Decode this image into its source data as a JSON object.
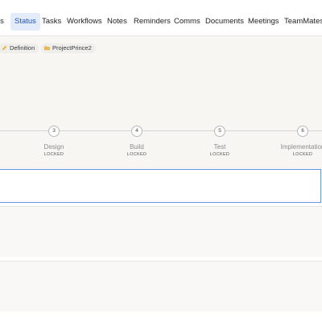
{
  "tabs": [
    {
      "label": "ls",
      "active": false
    },
    {
      "label": "Status",
      "active": true
    },
    {
      "label": "Tasks",
      "active": false
    },
    {
      "label": "Workflows",
      "active": false
    },
    {
      "label": "Notes",
      "active": false
    },
    {
      "label": "Reminders",
      "active": false
    },
    {
      "label": "Comms",
      "active": false
    },
    {
      "label": "Documents",
      "active": false
    },
    {
      "label": "Meetings",
      "active": false
    },
    {
      "label": "TeamMates",
      "active": false
    }
  ],
  "chips": [
    {
      "label": "Definition",
      "icon": "pencil-icon"
    },
    {
      "label": "ProjectPrince2",
      "icon": "folder-icon"
    }
  ],
  "stages": [
    {
      "number": "3",
      "name": "Design",
      "state": "LOCKED"
    },
    {
      "number": "4",
      "name": "Build",
      "state": "LOCKED"
    },
    {
      "number": "5",
      "name": "Test",
      "state": "LOCKED"
    },
    {
      "number": "6",
      "name": "Implementation",
      "state": "LOCKED"
    }
  ],
  "input": {
    "value": "",
    "placeholder": ""
  },
  "colors": {
    "accent": "#1a56c9",
    "active_tab_bg": "#e3ecfb",
    "input_border": "#6e96e6"
  }
}
